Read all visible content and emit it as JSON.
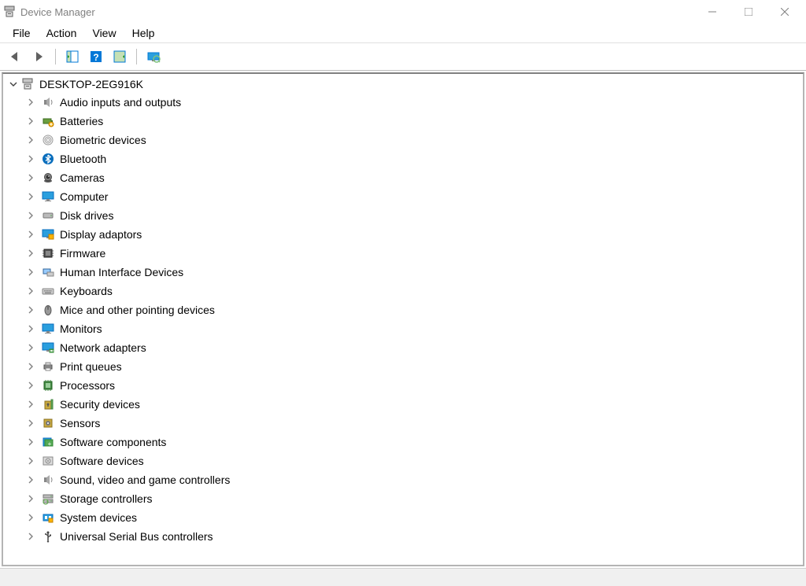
{
  "window": {
    "title": "Device Manager"
  },
  "menu": {
    "file": "File",
    "action": "Action",
    "view": "View",
    "help": "Help"
  },
  "tree": {
    "root": "DESKTOP-2EG916K",
    "items": [
      {
        "label": "Audio inputs and outputs",
        "icon": "speaker"
      },
      {
        "label": "Batteries",
        "icon": "battery"
      },
      {
        "label": "Biometric devices",
        "icon": "fingerprint"
      },
      {
        "label": "Bluetooth",
        "icon": "bluetooth"
      },
      {
        "label": "Cameras",
        "icon": "camera"
      },
      {
        "label": "Computer",
        "icon": "monitor"
      },
      {
        "label": "Disk drives",
        "icon": "disk"
      },
      {
        "label": "Display adaptors",
        "icon": "display"
      },
      {
        "label": "Firmware",
        "icon": "chip"
      },
      {
        "label": "Human Interface Devices",
        "icon": "hid"
      },
      {
        "label": "Keyboards",
        "icon": "keyboard"
      },
      {
        "label": "Mice and other pointing devices",
        "icon": "mouse"
      },
      {
        "label": "Monitors",
        "icon": "monitor"
      },
      {
        "label": "Network adapters",
        "icon": "network"
      },
      {
        "label": "Print queues",
        "icon": "printer"
      },
      {
        "label": "Processors",
        "icon": "cpu"
      },
      {
        "label": "Security devices",
        "icon": "security"
      },
      {
        "label": "Sensors",
        "icon": "sensor"
      },
      {
        "label": "Software components",
        "icon": "swcomp"
      },
      {
        "label": "Software devices",
        "icon": "swdev"
      },
      {
        "label": "Sound, video and game controllers",
        "icon": "speaker"
      },
      {
        "label": "Storage controllers",
        "icon": "storage"
      },
      {
        "label": "System devices",
        "icon": "system"
      },
      {
        "label": "Universal Serial Bus controllers",
        "icon": "usb"
      }
    ]
  }
}
